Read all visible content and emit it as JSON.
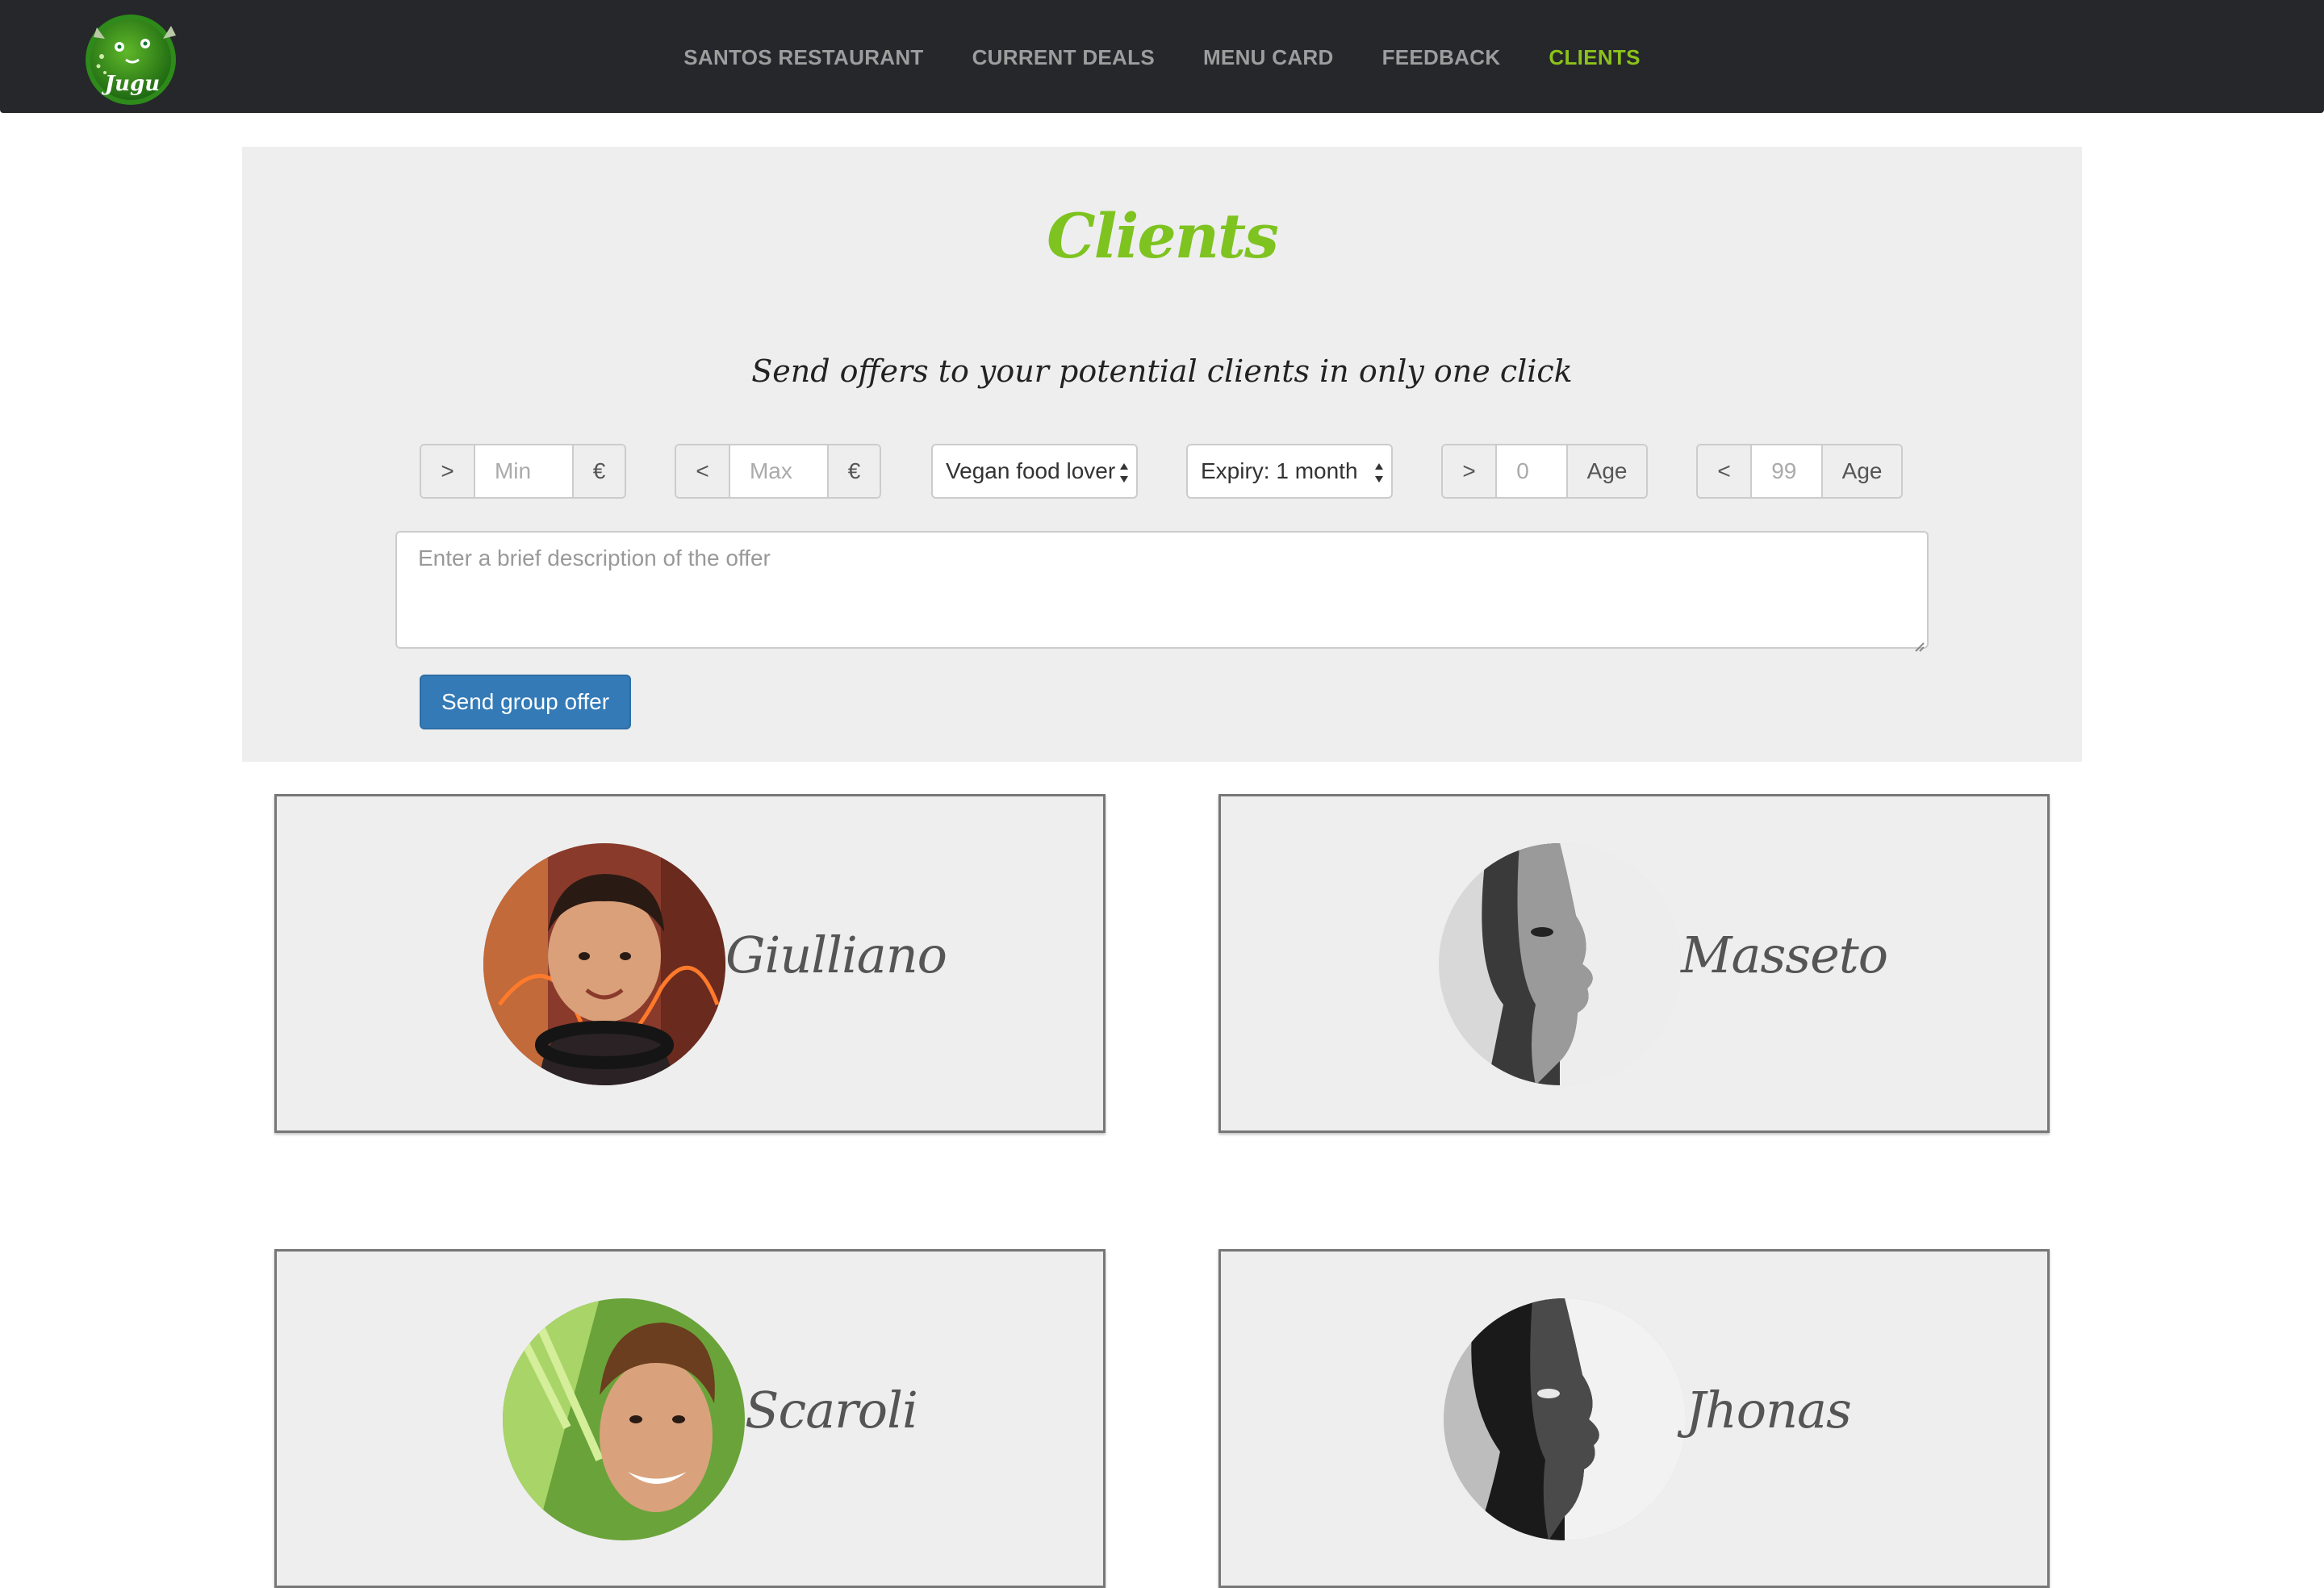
{
  "nav": {
    "items": [
      {
        "label": "SANTOS RESTAURANT"
      },
      {
        "label": "CURRENT DEALS"
      },
      {
        "label": "MENU CARD"
      },
      {
        "label": "FEEDBACK"
      },
      {
        "label": "CLIENTS",
        "active": true
      }
    ],
    "logo_text": "Jugu"
  },
  "page": {
    "title": "Clients",
    "subtitle": "Send offers to your potential clients in only one click"
  },
  "filters": {
    "min_price": {
      "prefix": ">",
      "placeholder": "Min",
      "suffix": "€"
    },
    "max_price": {
      "prefix": "<",
      "placeholder": "Max",
      "suffix": "€"
    },
    "category": {
      "selected": "Vegan food lover"
    },
    "expiry": {
      "selected": "Expiry: 1 month"
    },
    "min_age": {
      "prefix": ">",
      "placeholder": "0",
      "suffix": "Age"
    },
    "max_age": {
      "prefix": "<",
      "placeholder": "99",
      "suffix": "Age"
    }
  },
  "description": {
    "placeholder": "Enter a brief description of the offer"
  },
  "send_button": {
    "label": "Send group offer"
  },
  "clients": [
    {
      "name": "Giulliano"
    },
    {
      "name": "Masseto"
    },
    {
      "name": "Scaroli"
    },
    {
      "name": "Jhonas"
    }
  ],
  "colors": {
    "navbar_bg": "#25272b",
    "nav_active": "#8cc21a",
    "nav_inactive": "#9d9d9d",
    "accent_green": "#7ec31f",
    "button_blue": "#337ab7",
    "panel_bg": "#eeeeee"
  }
}
